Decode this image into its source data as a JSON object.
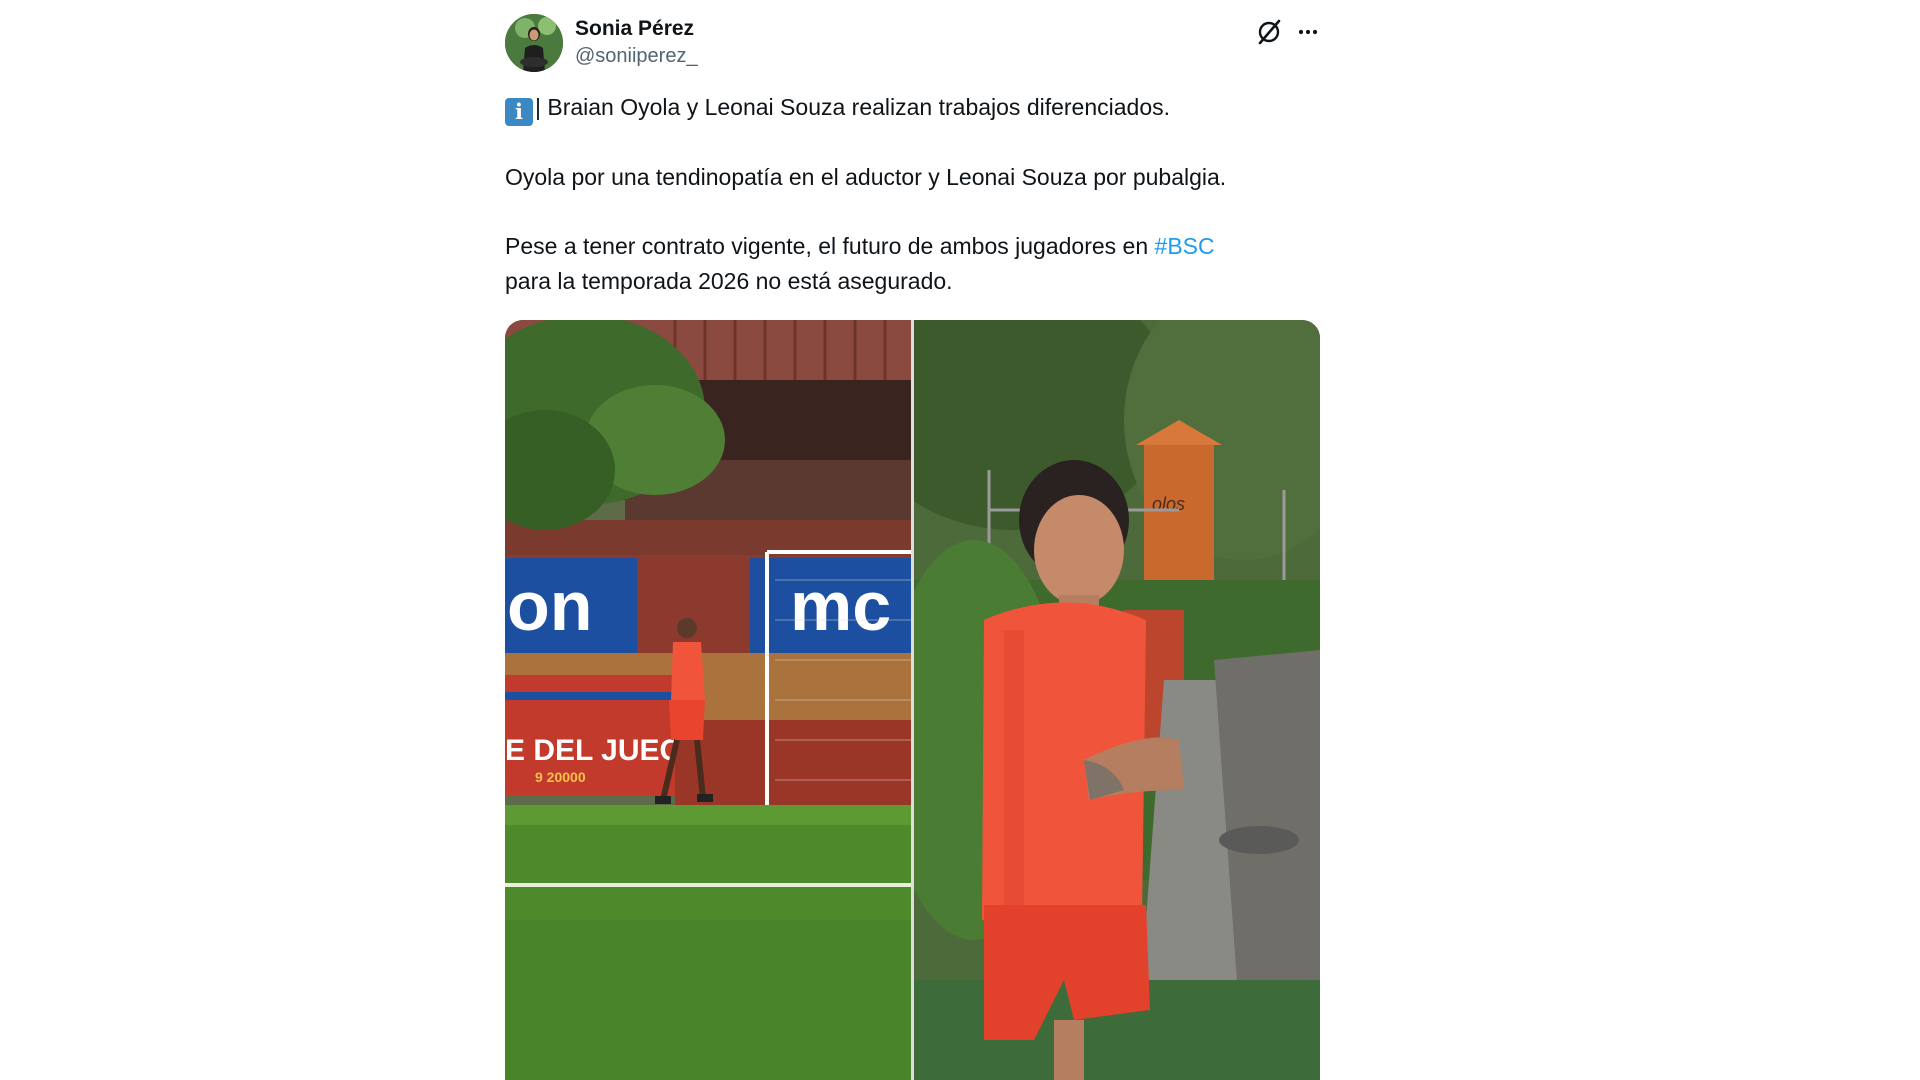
{
  "author": {
    "display_name": "Sonia Pérez",
    "handle": "@soniiperez_"
  },
  "header_icons": {
    "grok": "grok-icon",
    "more": "more-horizontal-icon"
  },
  "tweet": {
    "emoji": "i",
    "line1": "| Braian Oyola y Leonai Souza realizan trabajos diferenciados.",
    "line2": "Oyola por una tendinopatía en el aductor y Leonai Souza por pubalgia.",
    "line3_before": "Pese a tener contrato vigente, el futuro de ambos jugadores en ",
    "hashtag": "#BSC",
    "line4": "para la temporada 2026 no está asegurado."
  },
  "media": {
    "left_banner_text": "on",
    "left_banner_text2": "mc",
    "left_board_text": "E DEL JUEG",
    "left_board_sub": "9 20000",
    "right_sign_text": "olos"
  },
  "colors": {
    "hashtag": "#1d9bf0",
    "text": "#0f1419",
    "muted": "#536471",
    "jersey": "#f0553b"
  }
}
